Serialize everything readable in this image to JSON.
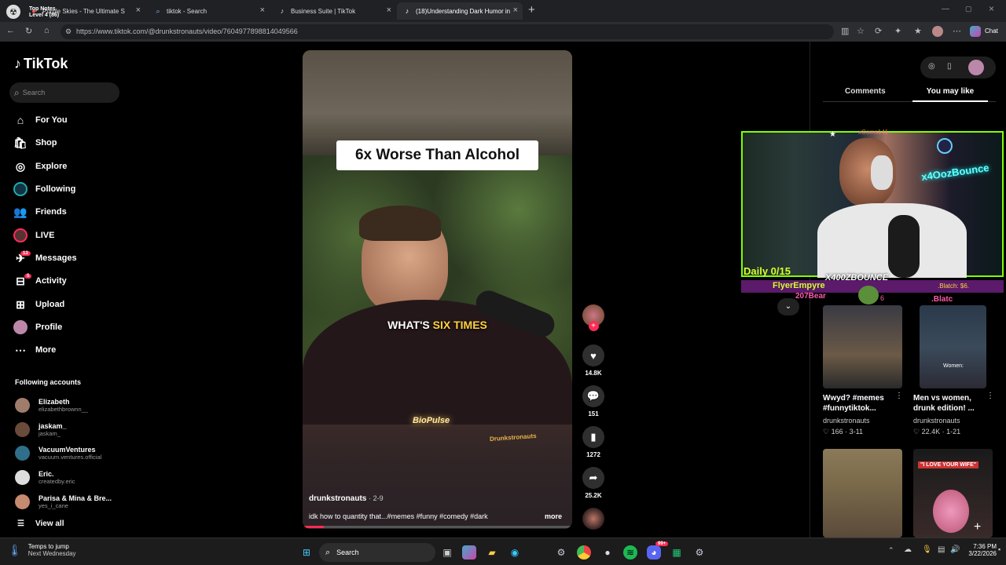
{
  "tabs": [
    {
      "label": "Purple Skies - The Ultimate S",
      "overlay1": "Top Notes",
      "overlay2": "Level 4 (86)"
    },
    {
      "label": "tiktok - Search"
    },
    {
      "label": "Business Suite | TikTok"
    },
    {
      "label": "(18)Understanding Dark Humor in"
    }
  ],
  "address": {
    "url": "https://www.tiktok.com/@drunkstronauts/video/7604977898814049566",
    "chat_label": "Chat"
  },
  "sidebar": {
    "logo": "TikTok",
    "search_placeholder": "Search",
    "items": [
      {
        "label": "For You",
        "icon": "home-icon"
      },
      {
        "label": "Shop",
        "icon": "shop-icon"
      },
      {
        "label": "Explore",
        "icon": "explore-icon"
      },
      {
        "label": "Following",
        "icon": "following-icon"
      },
      {
        "label": "Friends",
        "icon": "friends-icon"
      },
      {
        "label": "LIVE",
        "icon": "live-icon"
      },
      {
        "label": "Messages",
        "icon": "messages-icon",
        "badge": "13"
      },
      {
        "label": "Activity",
        "icon": "activity-icon",
        "badge": "5"
      },
      {
        "label": "Upload",
        "icon": "upload-icon"
      },
      {
        "label": "Profile",
        "icon": "profile-icon"
      },
      {
        "label": "More",
        "icon": "more-icon"
      }
    ],
    "following_title": "Following accounts",
    "accounts": [
      {
        "name": "Elizabeth",
        "handle": "elizabethbrownn__",
        "color": "#a07c6a"
      },
      {
        "name": "jaskam_",
        "handle": "jaskam_",
        "color": "#6a4a3a"
      },
      {
        "name": "VacuumVentures",
        "handle": "vacuum.ventures.official",
        "color": "#2f6f8a"
      },
      {
        "name": "Eric.",
        "handle": "createdby.eric",
        "color": "#dddddd"
      },
      {
        "name": "Parisa & Mina & Bre...",
        "handle": "yes_i_cane",
        "color": "#c58a6f"
      }
    ],
    "view_all": "View all"
  },
  "video": {
    "caption_top": "6x Worse Than Alcohol",
    "subtitle_a": "WHAT'S ",
    "subtitle_b": "SIX TIMES",
    "watermark1": "BioPulse",
    "watermark2": "Drunkstronauts",
    "author": "drunkstronauts",
    "date": "· 2-9",
    "description": "idk how to quantity that...#memes #funny #comedy #dark",
    "more_label": "more",
    "progress": 0.08
  },
  "actions": {
    "likes": "14.8K",
    "comments": "151",
    "saves": "1272",
    "shares": "25.2K"
  },
  "right_panel": {
    "tab_comments": "Comments",
    "tab_you_may_like": "You may like",
    "cards": [
      {
        "title": "Wwyd? #memes #funnytiktok...",
        "author": "drunkstronauts",
        "likes": "166",
        "date": "· 3-11"
      },
      {
        "title": "Men vs women, drunk edition! ...",
        "author": "drunkstronauts",
        "likes": "22.4K",
        "date": "· 1-21",
        "thumb_text": "Women:"
      },
      {
        "thumb_text": "\"I LOVE YOUR WIFE\""
      }
    ]
  },
  "stream_overlay": {
    "daily": "Daily 0/15",
    "name": "X400ZBOUNCE",
    "banner": "FlyerEmpyre",
    "user1": "207Bear",
    "user2": "xComs141",
    "tip": ".Blatch: $6.",
    "tip2": ".Blatc",
    "neon": "x4OozBounce",
    "digit": "6"
  },
  "taskbar": {
    "weather_title": "Temps to jump",
    "weather_sub": "Next Wednesday",
    "search_label": "Search",
    "time": "7:36 PM",
    "date": "3/22/2026",
    "discord_badge": "99+"
  },
  "colors": {
    "accent": "#fe2c55",
    "neon_green": "#7fff00",
    "highlight_yellow": "#ffd23f"
  }
}
